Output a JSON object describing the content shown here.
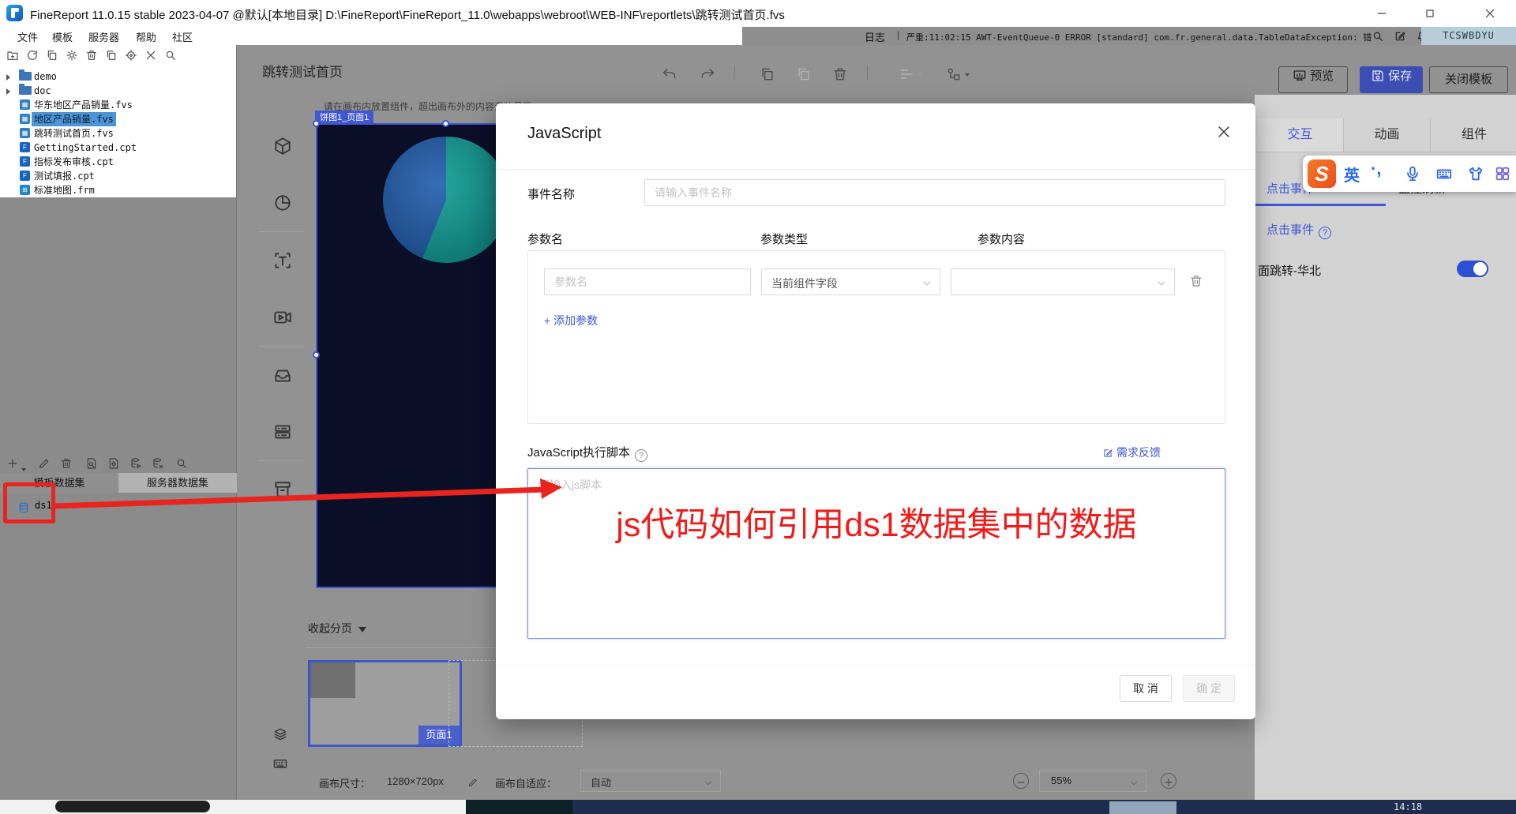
{
  "titlebar": {
    "app_title": "FineReport 11.0.15 stable 2023-04-07 @默认[本地目录]    D:\\FineReport\\FineReport_11.0\\webapps\\webroot\\WEB-INF\\reportlets\\跳转测试首页.fvs"
  },
  "menubar": {
    "items": [
      "文件",
      "模板",
      "服务器",
      "帮助",
      "社区"
    ],
    "log_label": "日志",
    "log_separator": "|",
    "log_message": "严重:11:02:15 AWT-EventQueue-0 ERROR [standard] com.fr.general.data.TableDataException: 错...",
    "log_icons": [
      "search-icon",
      "doc-edit-icon",
      "bell-icon"
    ],
    "ime_badge": "TCSWBDYU"
  },
  "quick_toolbar_icons": [
    "new-folder",
    "refresh",
    "copy-template",
    "settings",
    "delete",
    "duplicate",
    "locate",
    "close",
    "search"
  ],
  "file_tree": {
    "items": [
      {
        "label": "demo",
        "type": "folder"
      },
      {
        "label": "doc",
        "type": "folder"
      },
      {
        "label": "华东地区产品销量.fvs",
        "type": "fvs"
      },
      {
        "label": "地区产品销量.fvs",
        "type": "fvs",
        "selected": true
      },
      {
        "label": "跳转测试首页.fvs",
        "type": "fvs"
      },
      {
        "label": "GettingStarted.cpt",
        "type": "cpt"
      },
      {
        "label": "指标发布审核.cpt",
        "type": "cpt"
      },
      {
        "label": "测试填报.cpt",
        "type": "cpt"
      },
      {
        "label": "标准地图.frm",
        "type": "frm"
      }
    ]
  },
  "dataset_panel": {
    "toolbar_icons": [
      "add",
      "edit",
      "delete",
      "preview",
      "config",
      "db-run",
      "db-remove",
      "search"
    ],
    "tabs": [
      "模板数据集",
      "服务器数据集"
    ],
    "active_tab": "模板数据集",
    "items": [
      "ds1"
    ]
  },
  "canvas": {
    "title": "跳转测试首页",
    "header_icons": [
      "undo",
      "redo",
      "copy",
      "paste",
      "delete",
      "align",
      "arrange"
    ],
    "palette_icons": [
      "cube-3d",
      "pie-chart",
      "text-box",
      "video",
      "tray",
      "server-card",
      "archive-box",
      "layers",
      "keyboard"
    ],
    "hint": "请在画布内放置组件，超出画布外的内容无法显示",
    "widget_label": "饼图1_页面1",
    "pages_bar": {
      "collapse_label": "收起分页",
      "page1_label": "页面1"
    },
    "status_bar": {
      "canvas_size_label": "画布尺寸：",
      "canvas_size": "1280×720px",
      "fit_label": "画布自适应：",
      "fit_value": "自动",
      "zoom": "55%"
    }
  },
  "top_actions": {
    "preview": "预览",
    "save": "保存",
    "close_template": "关闭模板"
  },
  "right_panel": {
    "tabs": [
      "交互",
      "动画",
      "组件"
    ],
    "active_tab": "交互",
    "event_tabs": [
      "点击事件",
      "监控刷新"
    ],
    "section_title": "点击事件",
    "event_item": "面跳转-华北",
    "event_toggle_on": true
  },
  "ime_bar": {
    "logo": "S",
    "mode": "英",
    "punct": "·,",
    "icons": [
      "mic-icon",
      "keyboard-icon",
      "skin-icon",
      "toolbox-icon"
    ]
  },
  "dialog": {
    "title": "JavaScript",
    "event_name_label": "事件名称",
    "event_name_placeholder": "请输入事件名称",
    "param_headers": [
      "参数名",
      "参数类型",
      "参数内容"
    ],
    "param_name_placeholder": "参数名",
    "param_type_value": "当前组件字段",
    "param_content_value": "",
    "add_param": "+ 添加参数",
    "script_label": "JavaScript执行脚本",
    "feedback": "需求反馈",
    "script_placeholder": "请输入js脚本",
    "cancel": "取 消",
    "ok": "确 定"
  },
  "annotation": {
    "question": "js代码如何引用ds1数据集中的数据"
  },
  "taskbar": {
    "clock": "14:18"
  },
  "colors": {
    "accent_blue": "#3f56d6",
    "save_button_blue": "#3c4eb4",
    "annotation_red": "#f21b1b",
    "pie_teal": "#0f9d96",
    "pie_blue": "#1e5cab",
    "canvas_gray": "#929292"
  }
}
